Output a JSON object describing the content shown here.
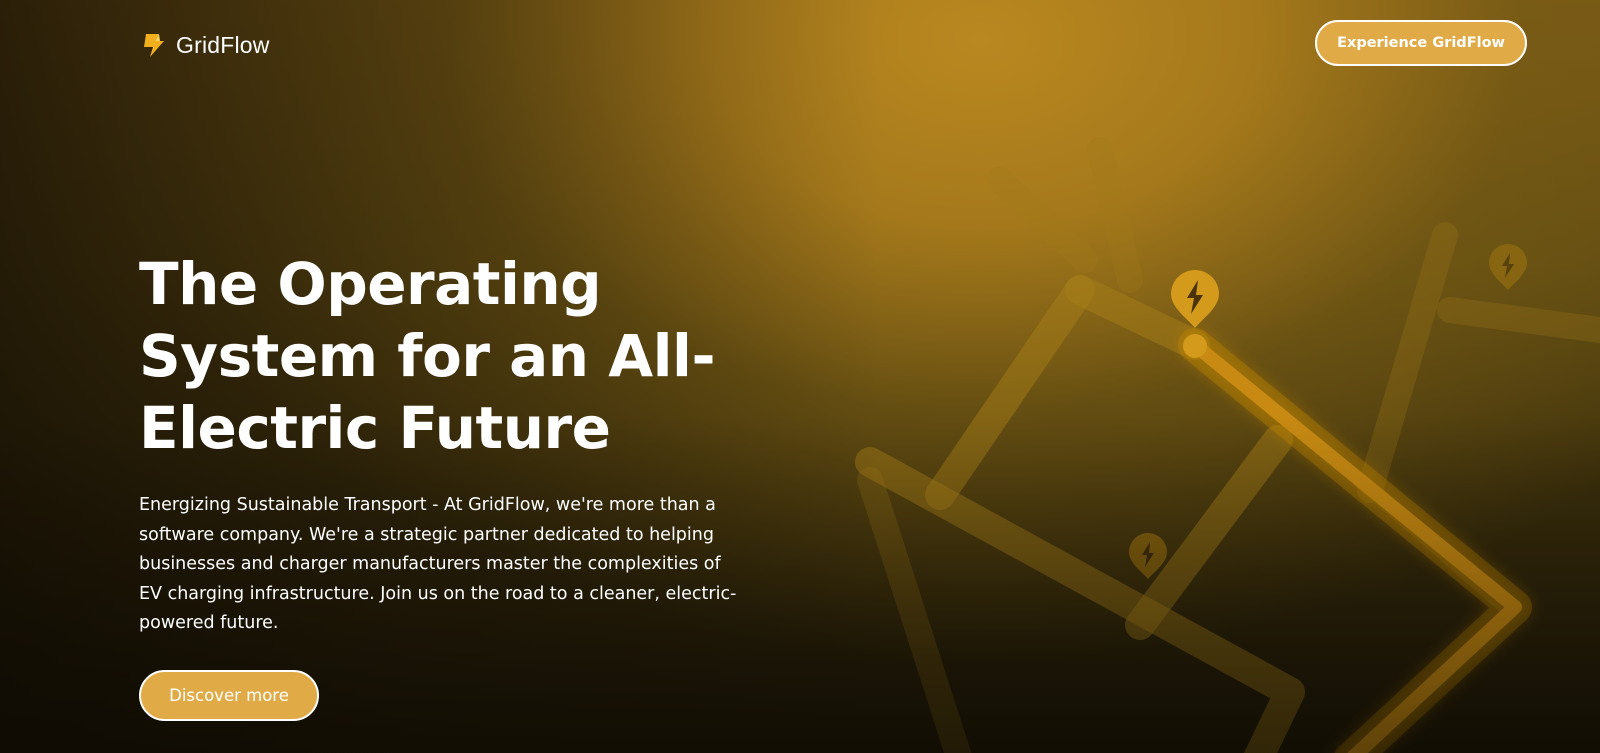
{
  "brand": {
    "name": "GridFlow",
    "logo_icon": "lightning-bolt-icon"
  },
  "header": {
    "cta_label": "Experience GridFlow"
  },
  "hero": {
    "headline": "The Operating System for an All-Electric Future",
    "description": "Energizing Sustainable Transport - At GridFlow, we're more than a software company. We're a strategic partner dedicated to helping businesses and charger manufacturers master the complexities of EV charging infrastructure. Join us on the road to a cleaner, electric-powered future.",
    "cta_label": "Discover more"
  },
  "map": {
    "icons": [
      "map-pin-charging-icon",
      "map-pin-charging-icon",
      "map-pin-charging-icon"
    ]
  },
  "colors": {
    "accent": "#e0ab47",
    "background_warm": "#b0821f",
    "background_dark": "#1b1507",
    "route_highlight": "#c4860f",
    "text": "#ffffff"
  }
}
